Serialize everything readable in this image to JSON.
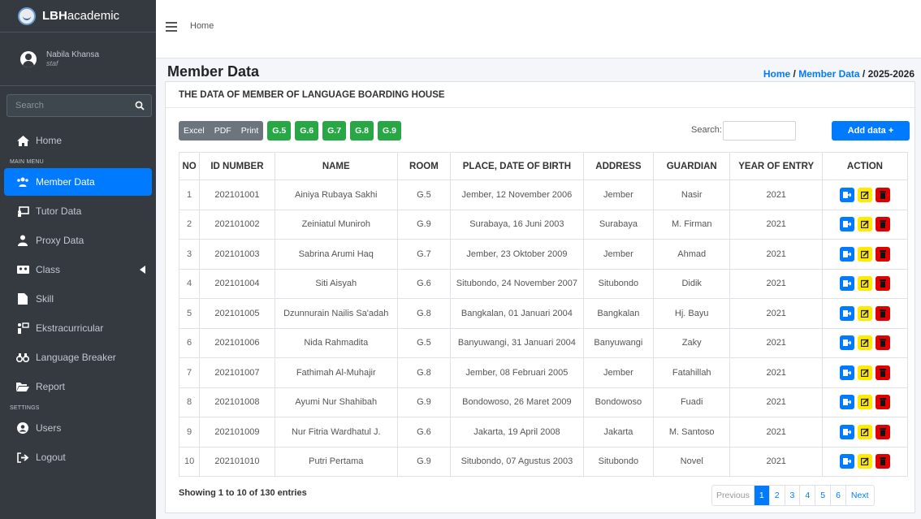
{
  "brand": {
    "bold": "LBH",
    "rest": "academic"
  },
  "user": {
    "name": "Nabila Khansa",
    "role": "staf"
  },
  "sidebar_search": {
    "placeholder": "Search"
  },
  "nav": {
    "home": "Home",
    "main_menu_header": "MAIN MENU",
    "member": "Member Data",
    "tutor": "Tutor Data",
    "proxy": "Proxy Data",
    "class": "Class",
    "skill": "Skill",
    "ekstra": "Ekstracurricular",
    "breaker": "Language Breaker",
    "report": "Report",
    "settings_header": "SETTINGS",
    "users": "Users",
    "logout": "Logout"
  },
  "topbar": {
    "home": "Home"
  },
  "header": {
    "title": "Member Data",
    "bc_home": "Home",
    "bc_sep1": " / ",
    "bc_member": "Member Data",
    "bc_sep2": " / ",
    "bc_year": "2025-2026"
  },
  "card_title": "THE DATA OF MEMBER OF LANGUAGE BOARDING HOUSE",
  "toolbar": {
    "excel": "Excel",
    "pdf": "PDF",
    "print": "Print",
    "groups": [
      "G.5",
      "G.6",
      "G.7",
      "G.8",
      "G.9"
    ],
    "search_label": "Search:",
    "add": "Add data +"
  },
  "columns": [
    "NO",
    "ID NUMBER",
    "NAME",
    "ROOM",
    "PLACE, DATE OF BIRTH",
    "ADDRESS",
    "GUARDIAN",
    "YEAR OF ENTRY",
    "ACTION"
  ],
  "rows": [
    [
      "1",
      "202101001",
      "Ainiya Rubaya Sakhi",
      "G.5",
      "Jember, 12 November 2006",
      "Jember",
      "Nasir",
      "2021"
    ],
    [
      "2",
      "202101002",
      "Zeiniatul Muniroh",
      "G.9",
      "Surabaya, 16 Juni 2003",
      "Surabaya",
      "M. Firman",
      "2021"
    ],
    [
      "3",
      "202101003",
      "Sabrina Arumi Haq",
      "G.7",
      "Jember, 23 Oktober 2009",
      "Jember",
      "Ahmad",
      "2021"
    ],
    [
      "4",
      "202101004",
      "Siti Aisyah",
      "G.6",
      "Situbondo, 24 November 2007",
      "Situbondo",
      "Didik",
      "2021"
    ],
    [
      "5",
      "202101005",
      "Dzunnurain Nailis Sa'adah",
      "G.8",
      "Bangkalan, 01 Januari 2004",
      "Bangkalan",
      "Hj. Bayu",
      "2021"
    ],
    [
      "6",
      "202101006",
      "Nida Rahmadita",
      "G.5",
      "Banyuwangi, 31 Januari 2004",
      "Banyuwangi",
      "Zaky",
      "2021"
    ],
    [
      "7",
      "202101007",
      "Fathimah Al-Muhajir",
      "G.8",
      "Jember, 08 Februari 2005",
      "Jember",
      "Fatahillah",
      "2021"
    ],
    [
      "8",
      "202101008",
      "Ayumi Nur Shahibah",
      "G.9",
      "Bondowoso, 26 Maret 2009",
      "Bondowoso",
      "Fuadi",
      "2021"
    ],
    [
      "9",
      "202101009",
      "Nur Fitria Wardhatul J.",
      "G.6",
      "Jakarta, 19 April 2008",
      "Jakarta",
      "M. Santoso",
      "2021"
    ],
    [
      "10",
      "202101010",
      "Putri Pertama",
      "G.9",
      "Situbondo, 07 Agustus 2003",
      "Situbondo",
      "Novel",
      "2021"
    ]
  ],
  "footer": {
    "showing": "Showing 1 to 10 of 130 entries",
    "pages": [
      "Previous",
      "1",
      "2",
      "3",
      "4",
      "5",
      "6",
      "Next"
    ],
    "current_page": "1"
  },
  "colors": {
    "primary": "#007bff",
    "success": "#28a745",
    "sidebar": "#343a40",
    "warning": "#ffeb00",
    "danger": "#e00000"
  }
}
